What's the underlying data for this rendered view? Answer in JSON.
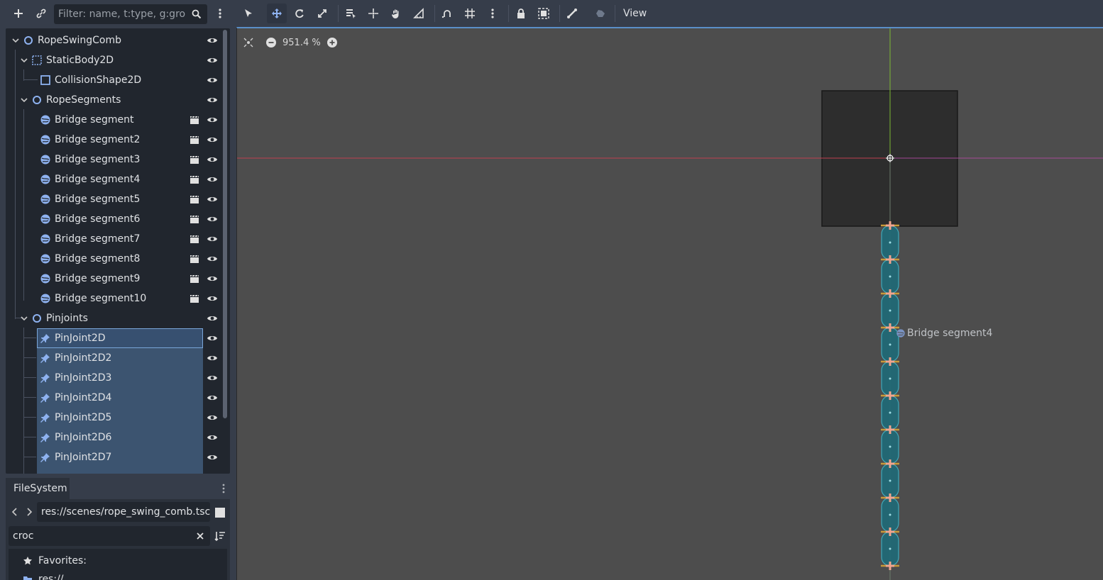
{
  "scene_toolbar": {
    "filter_placeholder": "Filter: name, t:type, g:group"
  },
  "scene_tree": {
    "nodes": [
      {
        "label": "RopeSwingComb",
        "type": "Node2D"
      },
      {
        "label": "StaticBody2D",
        "type": "StaticBody2D"
      },
      {
        "label": "CollisionShape2D",
        "type": "CollisionShape2D"
      },
      {
        "label": "RopeSegments",
        "type": "Node2D"
      },
      {
        "label": "Bridge segment",
        "type": "scene-instance"
      },
      {
        "label": "Bridge segment2",
        "type": "scene-instance"
      },
      {
        "label": "Bridge segment3",
        "type": "scene-instance"
      },
      {
        "label": "Bridge segment4",
        "type": "scene-instance"
      },
      {
        "label": "Bridge segment5",
        "type": "scene-instance"
      },
      {
        "label": "Bridge segment6",
        "type": "scene-instance"
      },
      {
        "label": "Bridge segment7",
        "type": "scene-instance"
      },
      {
        "label": "Bridge segment8",
        "type": "scene-instance"
      },
      {
        "label": "Bridge segment9",
        "type": "scene-instance"
      },
      {
        "label": "Bridge segment10",
        "type": "scene-instance"
      },
      {
        "label": "Pinjoints",
        "type": "Node2D"
      },
      {
        "label": "PinJoint2D",
        "type": "PinJoint2D"
      },
      {
        "label": "PinJoint2D2",
        "type": "PinJoint2D"
      },
      {
        "label": "PinJoint2D3",
        "type": "PinJoint2D"
      },
      {
        "label": "PinJoint2D4",
        "type": "PinJoint2D"
      },
      {
        "label": "PinJoint2D5",
        "type": "PinJoint2D"
      },
      {
        "label": "PinJoint2D6",
        "type": "PinJoint2D"
      },
      {
        "label": "PinJoint2D7",
        "type": "PinJoint2D"
      }
    ]
  },
  "filesystem": {
    "tab_label": "FileSystem",
    "path": "res://scenes/rope_swing_comb.tsc",
    "search_value": "croc",
    "favorites_label": "Favorites:",
    "res_label": "res://"
  },
  "top_toolbar": {
    "view_label": "View"
  },
  "viewport": {
    "zoom_level": "951.4 %",
    "hover_node_label": "Bridge segment4"
  },
  "colors": {
    "accent": "#5a8fc8",
    "selection": "#3c5470",
    "icon_blue": "#8eb2f0",
    "x_axis": "#c0404f",
    "y_axis": "#7cb832",
    "segment_fill": "#1f6a78",
    "joint": "#f2a58e"
  }
}
